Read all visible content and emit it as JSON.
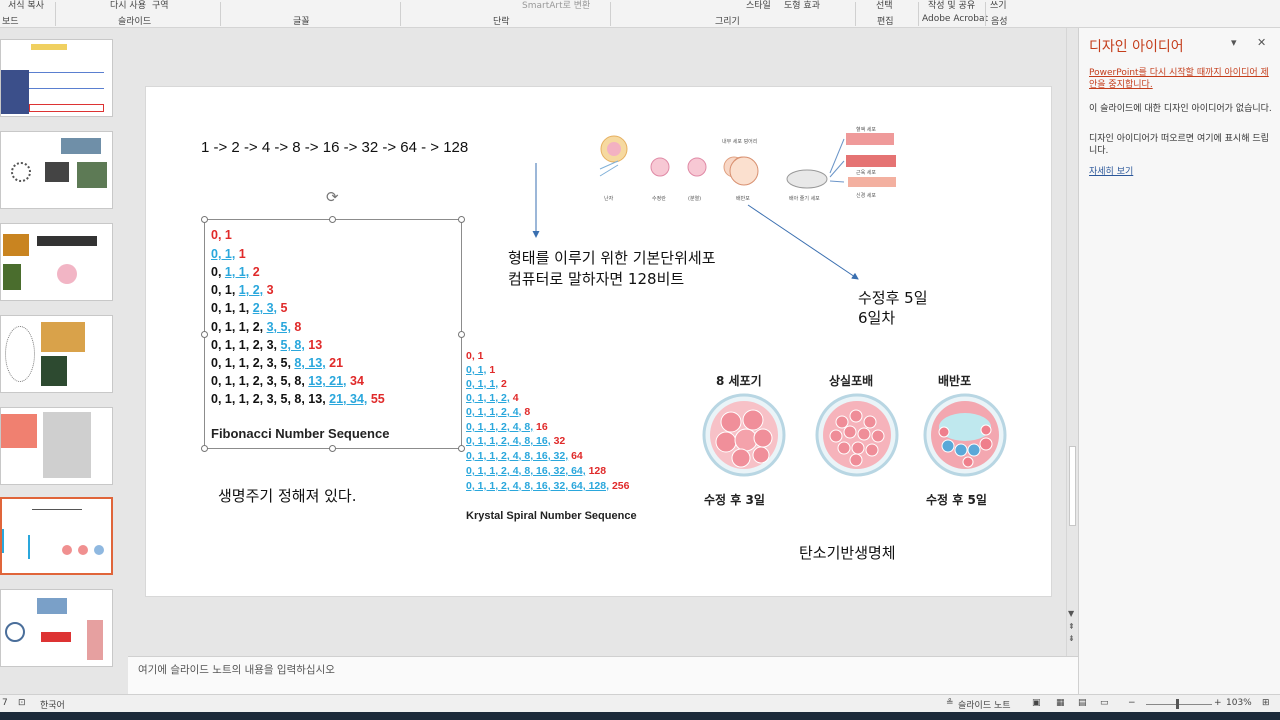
{
  "ribbon": {
    "top_items": [
      "서식 복사",
      "다시 사용",
      "구역",
      "SmartArt로 변환",
      "스타일",
      "도형 효과",
      "선택",
      "작성 및 공유",
      "쓰기"
    ],
    "groups": [
      "보드",
      "슬라이드",
      "글꼴",
      "단락",
      "그리기",
      "편집",
      "Adobe Acrobat",
      "음성"
    ]
  },
  "slide": {
    "top_sequence": "1 -> 2 -> 4 -> 8 -> 16 -> 32 -> 64 - > 128",
    "fibonacci": {
      "rows": [
        {
          "k": "",
          "b": "",
          "r": "0, 1"
        },
        {
          "k": "",
          "b": "0, 1,",
          "r": " 1"
        },
        {
          "k": "0, ",
          "b": "1, 1,",
          "r": " 2"
        },
        {
          "k": "0, 1, ",
          "b": "1, 2,",
          "r": " 3"
        },
        {
          "k": "0, 1, 1, ",
          "b": "2, 3,",
          "r": " 5"
        },
        {
          "k": "0, 1, 1, 2, ",
          "b": "3, 5,",
          "r": " 8"
        },
        {
          "k": "0, 1, 1, 2, 3, ",
          "b": "5, 8,",
          "r": " 13"
        },
        {
          "k": "0, 1, 1, 2, 3, 5, ",
          "b": "8, 13,",
          "r": " 21"
        },
        {
          "k": "0, 1, 1, 2, 3, 5, 8, ",
          "b": "13, 21,",
          "r": " 34"
        },
        {
          "k": "0, 1, 1, 2, 3, 5, 8, 13, ",
          "b": "21, 34,",
          "r": " 55"
        }
      ],
      "title": "Fibonacci Number Sequence"
    },
    "krystal": {
      "rows": [
        {
          "b": "",
          "r": "0, 1"
        },
        {
          "b": "0, 1,",
          "r": " 1"
        },
        {
          "b": "0, 1, 1,",
          "r": " 2"
        },
        {
          "b": "0, 1, 1, 2,",
          "r": " 4"
        },
        {
          "b": "0, 1, 1, 2, 4,",
          "r": " 8"
        },
        {
          "b": "0, 1, 1, 2, 4, 8,",
          "r": " 16"
        },
        {
          "b": "0, 1, 1, 2, 4, 8, 16,",
          "r": " 32"
        },
        {
          "b": "0, 1, 1, 2, 4, 8, 16, 32,",
          "r": " 64"
        },
        {
          "b": "0, 1, 1, 2, 4, 8, 16, 32, 64,",
          "r": " 128"
        },
        {
          "b": "0, 1, 1, 2, 4, 8, 16, 32, 64, 128,",
          "r": " 256"
        }
      ],
      "title": "Krystal Spiral Number Sequence"
    },
    "note_basic_cell_line1": "형태를 이루기 위한 기본단위세포",
    "note_basic_cell_line2": "컴퓨터로 말하자면 128비트",
    "note_day_line1": "수정후 5일",
    "note_day_line2": "6일차",
    "note_lifespan": "생명주기 정해져 있다.",
    "note_carbon": "탄소기반생명체",
    "embryo_labels": [
      "8 세포기",
      "상실포배",
      "배반포"
    ],
    "embryo_days": [
      "수정 후 3일",
      "수정 후 5일"
    ],
    "cell_image_labels": [
      "난자",
      "수정란",
      "(분열)",
      "배반포",
      "배아 줄기 세포",
      "내부 세포 덩어리",
      "혈액 세포",
      "근육 세포",
      "신경 세포"
    ]
  },
  "notes_placeholder": "여기에 슬라이드 노트의 내용을 입력하십시오",
  "design_pane": {
    "title": "디자인 아이디어",
    "warning": "PowerPoint를 다시 시작할 때까지 아이디어 제안을 중지합니다.",
    "text1": "이 슬라이드에 대한 디자인 아이디어가 없습니다.",
    "text2": "디자인 아이디어가 떠오르면 여기에 표시해 드립니다.",
    "link": "자세히 보기"
  },
  "status": {
    "slide_num": "7",
    "language": "한국어",
    "notes_btn": "슬라이드 노트",
    "zoom": "103%"
  },
  "colors": {
    "accent": "#c43e1c",
    "fib_blue": "#2aa7dc",
    "fib_red": "#e02a2a",
    "selected_thumb": "#e0653a"
  }
}
